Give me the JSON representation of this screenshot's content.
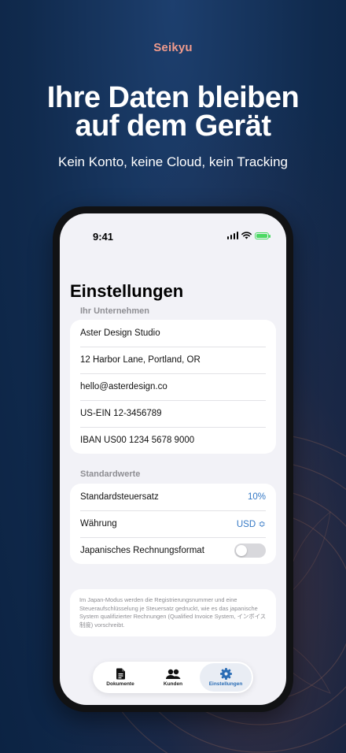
{
  "brand": "Seikyu",
  "headline": {
    "line1": "Ihre Daten bleiben",
    "line2": "auf dem Gerät"
  },
  "subline": "Kein Konto, keine Cloud, kein Tracking",
  "status": {
    "time": "9:41"
  },
  "settings": {
    "title": "Einstellungen",
    "company_section": "Ihr Unternehmen",
    "company_rows": [
      "Aster Design Studio",
      "12 Harbor Lane, Portland, OR",
      "hello@asterdesign.co",
      "US-EIN 12-3456789",
      "IBAN US00 1234 5678 9000"
    ],
    "defaults_section": "Standardwerte",
    "tax_label": "Standardsteuersatz",
    "tax_value": "10%",
    "currency_label": "Währung",
    "currency_value": "USD ≎",
    "japan_label": "Japanisches Rechnungsformat",
    "japan_enabled": false,
    "note": "Im Japan-Modus werden die Registrierungsnummer und eine Steueraufschlüsselung je Steuersatz gedruckt, wie es das japanische System qualifizierter Rechnungen (Qualified Invoice System, インボイス制度) vorschreibt."
  },
  "tabs": [
    {
      "label": "Dokumente",
      "icon": "document-icon",
      "active": false
    },
    {
      "label": "Kunden",
      "icon": "people-icon",
      "active": false
    },
    {
      "label": "Einstellungen",
      "icon": "gear-icon",
      "active": true
    }
  ],
  "colors": {
    "accent": "#3478c5",
    "brand": "#f09b8c",
    "background": "#102a4d"
  }
}
